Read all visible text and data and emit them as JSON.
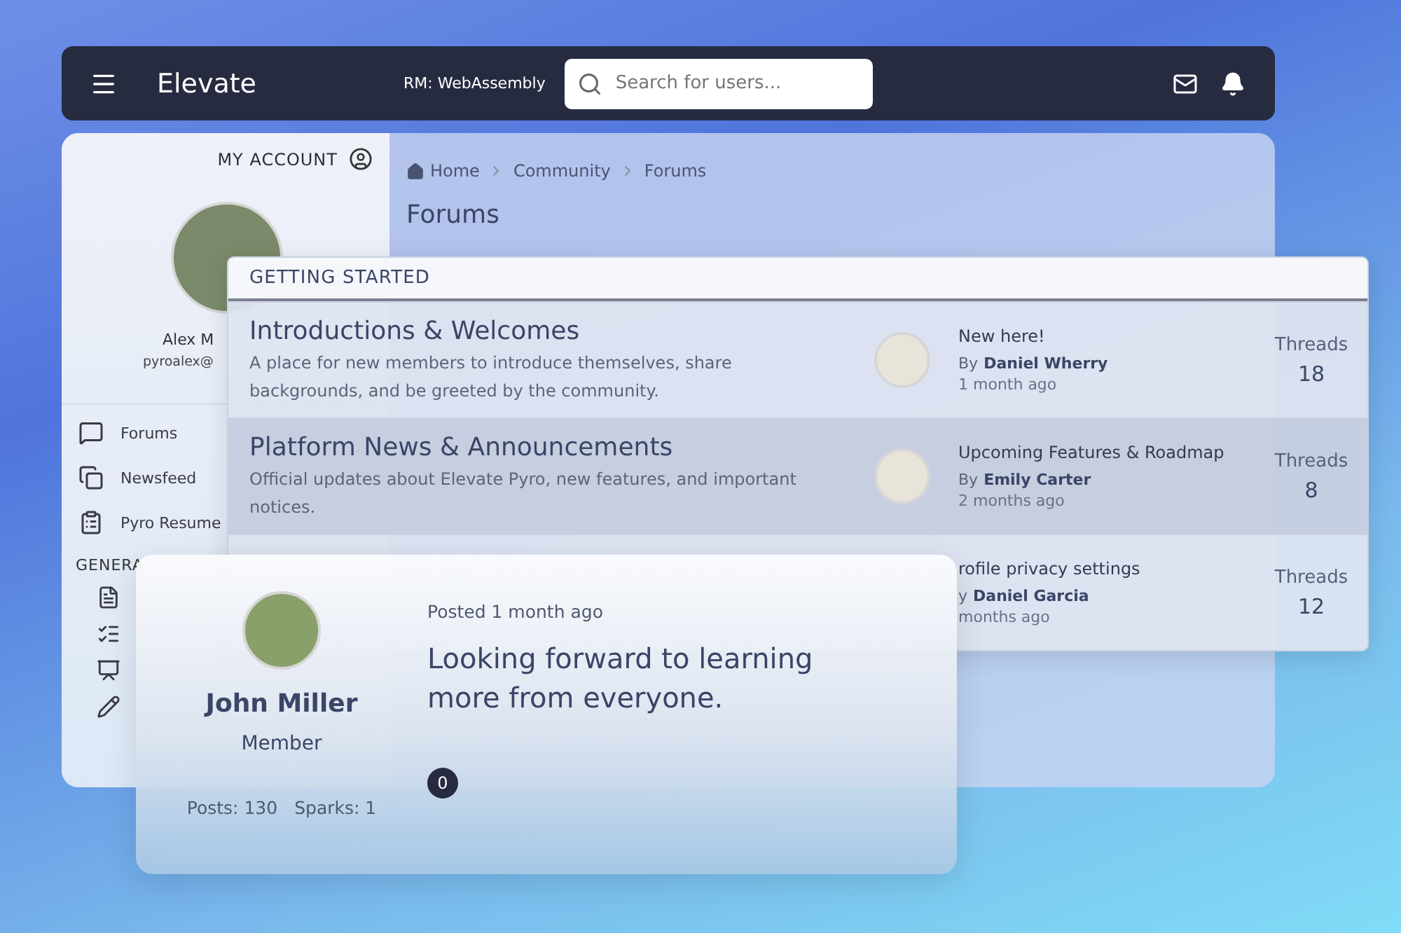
{
  "top_bar": {
    "title": "Elevate",
    "room": "RM: WebAssembly",
    "search": {
      "placeholder": "Search for users..."
    }
  },
  "sidebar": {
    "account_label": "MY ACCOUNT",
    "user_name": "Alex M",
    "user_email": "pyroalex@",
    "nav": [
      {
        "kind": "forums",
        "label": "Forums"
      },
      {
        "kind": "newsfeed",
        "label": "Newsfeed"
      },
      {
        "kind": "resume",
        "label": "Pyro Resume"
      }
    ],
    "section_heading": "GENERA",
    "tools": [
      {
        "kind": "document"
      },
      {
        "kind": "checklist"
      },
      {
        "kind": "presentation"
      },
      {
        "kind": "pencil"
      }
    ]
  },
  "breadcrumb": [
    "Home",
    "Community",
    "Forums"
  ],
  "page_title": "Forums",
  "forum_category": {
    "heading": "GETTING STARTED",
    "forums": [
      {
        "title": "Introductions & Welcomes",
        "description": "A place for new members to introduce themselves, share backgrounds, and be greeted by the community.",
        "highlighted": false,
        "latest": {
          "title": "New here!",
          "by": "By",
          "author": "Daniel Wherry",
          "time": "1 month ago",
          "avatar": true
        },
        "stat_label": "Threads",
        "stat_value": "18"
      },
      {
        "title": "Platform News & Announcements",
        "description": "Official updates about Elevate Pyro, new features, and important notices.",
        "highlighted": true,
        "latest": {
          "title": "Upcoming Features & Roadmap",
          "by": "By",
          "author": "Emily Carter",
          "time": "2 months ago",
          "avatar": true
        },
        "stat_label": "Threads",
        "stat_value": "8"
      },
      {
        "highlighted": false,
        "latest": {
          "title": "rofile privacy settings",
          "by": "y",
          "author": "Daniel Garcia",
          "time": "months ago",
          "avatar": false
        },
        "stat_label": "Threads",
        "stat_value": "12"
      }
    ]
  },
  "post": {
    "author": "John Miller",
    "role": "Member",
    "posts": "Posts: 130",
    "sparks": "Sparks: 1",
    "posted": "Posted 1 month ago",
    "body": "Looking forward to learning more from everyone.",
    "reactions": "0"
  }
}
